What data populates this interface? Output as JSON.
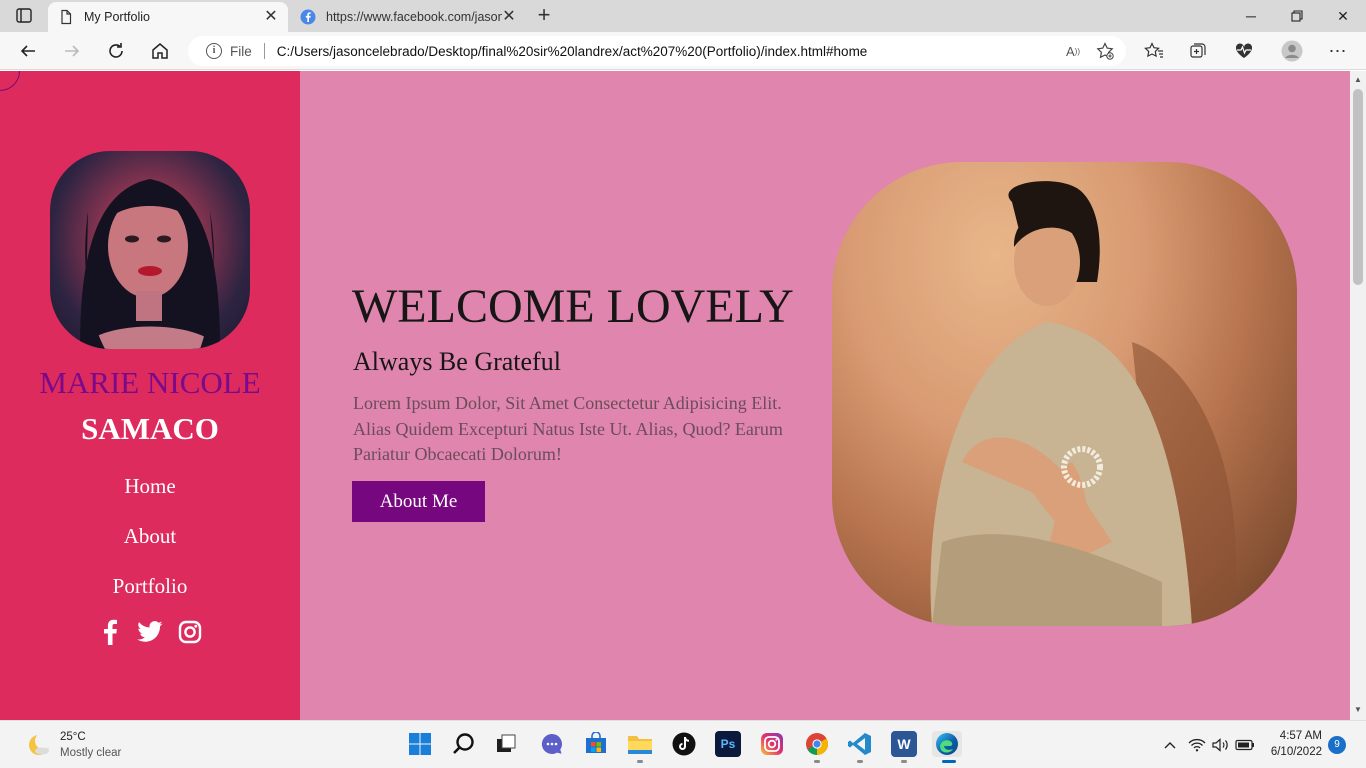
{
  "browser": {
    "tabs": [
      {
        "title": "My Portfolio",
        "active": true
      },
      {
        "title": "https://www.facebook.com/jason",
        "active": false
      }
    ],
    "address": {
      "file_label": "File",
      "url": "C:/Users/jasoncelebrado/Desktop/final%20sir%20landrex/act%207%20(Portfolio)/index.html#home"
    }
  },
  "sidebar": {
    "name_first": "MARIE NICOLE",
    "name_last": "SAMACO",
    "nav": [
      "Home",
      "About",
      "Portfolio"
    ],
    "socials": [
      "facebook-icon",
      "twitter-icon",
      "instagram-icon"
    ]
  },
  "hero": {
    "title": "WELCOME LOVELY",
    "subtitle": "Always Be Grateful",
    "text": "Lorem Ipsum Dolor, Sit Amet Consectetur Adipisicing Elit. Alias Quidem Excepturi Natus Iste Ut. Alias, Quod? Earum Pariatur Obcaecati Dolorum!",
    "button": "About Me"
  },
  "colors": {
    "sidebar_bg": "#de2b5e",
    "page_bg": "#e085ad",
    "accent": "#77077f"
  },
  "taskbar": {
    "weather_temp": "25°C",
    "weather_cond": "Mostly clear",
    "time": "4:57 AM",
    "date": "6/10/2022",
    "notifications": "9"
  }
}
